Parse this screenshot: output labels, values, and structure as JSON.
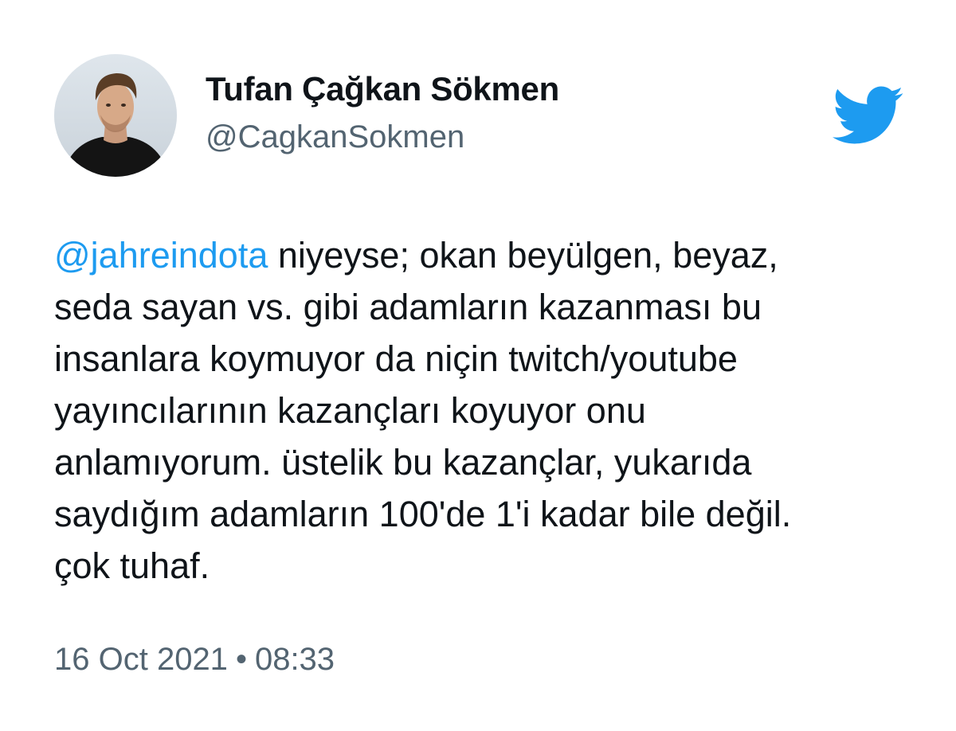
{
  "author": {
    "display_name": "Tufan Çağkan Sökmen",
    "handle": "@CagkanSokmen"
  },
  "icons": {
    "brand": "twitter-bird-icon",
    "brand_color": "#1d9bf0"
  },
  "tweet": {
    "mention": "@jahreindota",
    "line_1_rest": " niyeyse; okan beyülgen, beyaz,",
    "lines": [
      "seda sayan vs. gibi adamların kazanması bu",
      "insanlara koymuyor da niçin twitch/youtube",
      "yayıncılarının kazançları koyuyor onu",
      "anlamıyorum. üstelik bu kazançlar, yukarıda",
      "saydığım adamların 100'de 1'i kadar bile değil.",
      "çok tuhaf."
    ]
  },
  "meta": {
    "date": "16 Oct 2021",
    "separator": "•",
    "time": "08:33"
  }
}
